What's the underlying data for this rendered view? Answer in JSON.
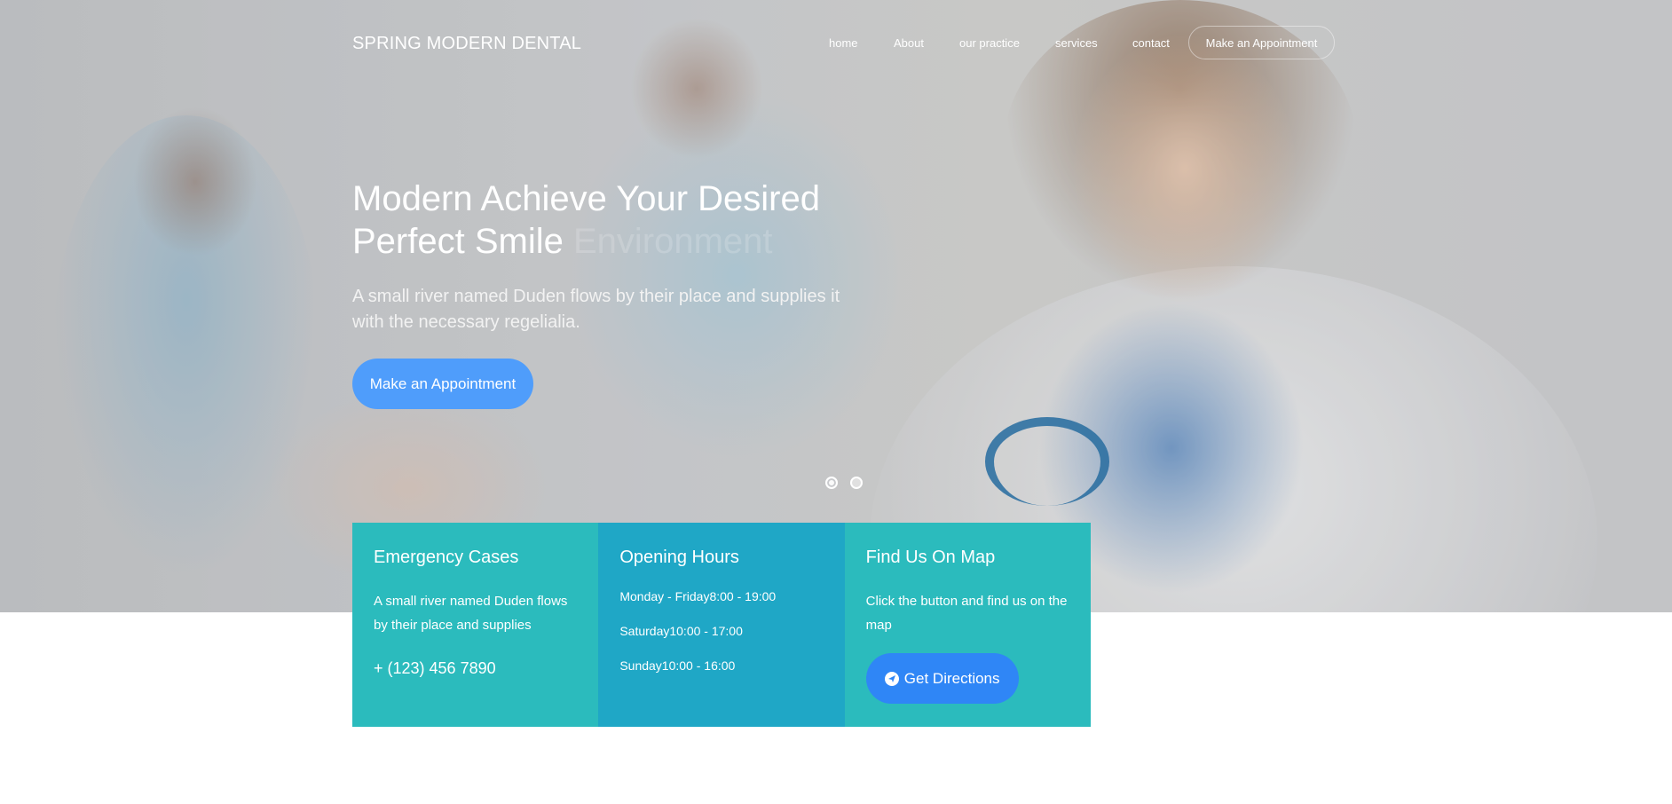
{
  "brand": "SPRING MODERN DENTAL",
  "nav": {
    "items": [
      "home",
      "About",
      "our practice",
      "services",
      "contact"
    ],
    "cta": "Make an Appointment"
  },
  "hero": {
    "title_main": "Modern Achieve Your Desired Perfect Smile",
    "title_faded": "Environment",
    "subtitle": "A small river named Duden flows by their place and supplies it with the necessary regelialia.",
    "cta": "Make an Appointment",
    "slides": [
      {
        "active": true
      },
      {
        "active": false
      }
    ]
  },
  "cards": {
    "emergency": {
      "title": "Emergency Cases",
      "text": "A small river named Duden flows by their place and supplies",
      "phone": "+ (123) 456 7890"
    },
    "hours": {
      "title": "Opening Hours",
      "rows": [
        "Monday - Friday8:00 - 19:00",
        "Saturday10:00 - 17:00",
        "Sunday10:00 - 16:00"
      ]
    },
    "map": {
      "title": "Find Us On Map",
      "text": "Click the button and find us on the map",
      "button": "Get Directions",
      "button_icon": "send-icon"
    }
  },
  "colors": {
    "accent": "#4f9dfb",
    "card_teal": "#2bbbbd",
    "card_blue": "#1fa7c6",
    "directions_button": "#2f86f6"
  }
}
